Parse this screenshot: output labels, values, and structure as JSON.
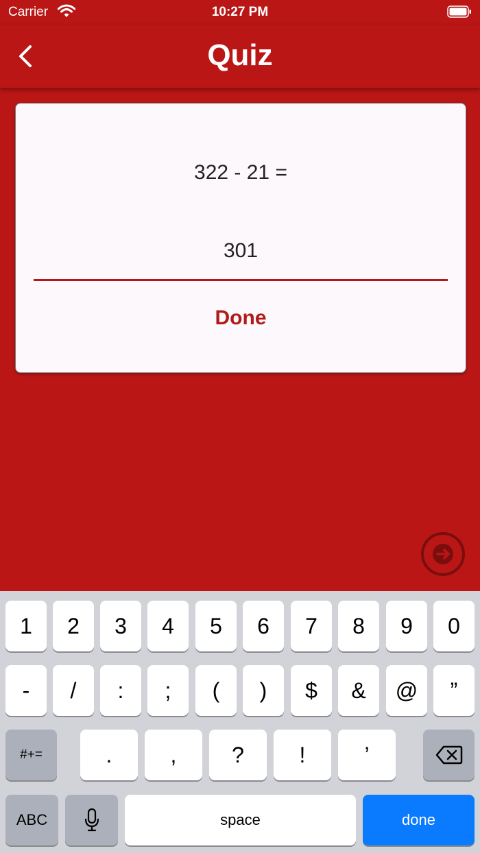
{
  "status_bar": {
    "carrier": "Carrier",
    "time": "10:27 PM"
  },
  "nav": {
    "title": "Quiz",
    "back_icon": "chevron-left-icon"
  },
  "quiz": {
    "question": "322 - 21 =",
    "answer": "301",
    "done_label": "Done",
    "next_icon": "arrow-right-circle-icon"
  },
  "keyboard": {
    "row1": [
      "1",
      "2",
      "3",
      "4",
      "5",
      "6",
      "7",
      "8",
      "9",
      "0"
    ],
    "row2": [
      "-",
      "/",
      ":",
      ";",
      "(",
      ")",
      "$",
      "&",
      "@",
      "”"
    ],
    "row3": [
      ".",
      ",",
      "?",
      "!",
      "’"
    ],
    "symbols_key": "#+=",
    "abc_key": "ABC",
    "space_key": "space",
    "done_key": "done"
  },
  "colors": {
    "primary": "#BB1616",
    "card": "#FDF8FB",
    "keyboard_bg": "#D1D3D9",
    "blue": "#0A7AFF"
  }
}
